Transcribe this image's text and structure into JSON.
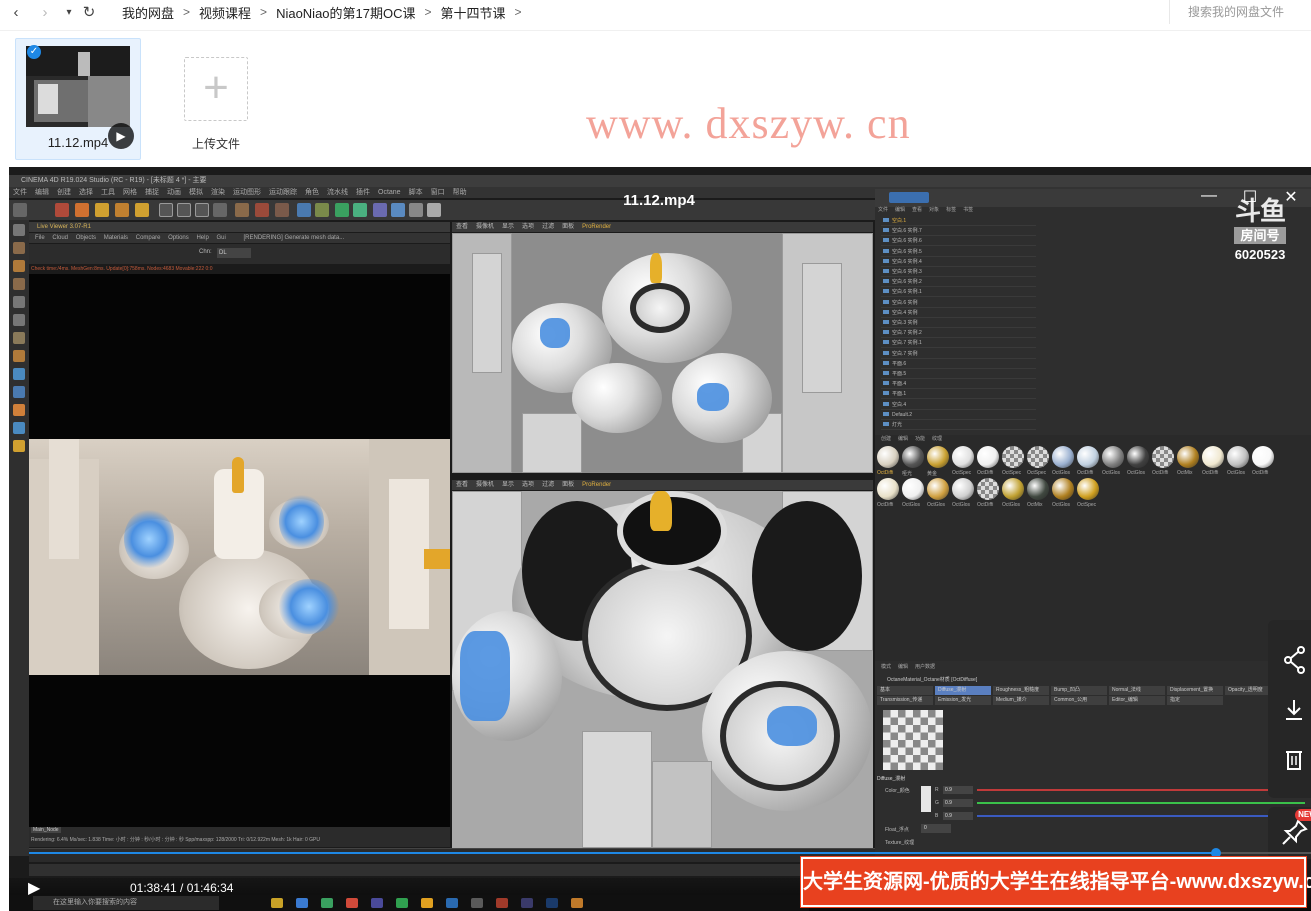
{
  "nav": {
    "back_icon": "‹",
    "forward_icon": "›",
    "history_icon": "▾",
    "refresh_icon": "↻",
    "breadcrumbs": [
      "我的网盘",
      "视频课程",
      "NiaoNiao的第17期OC课",
      "第十四节课"
    ],
    "separator": ">",
    "search_placeholder": "搜索我的网盘文件"
  },
  "files": {
    "selected_file": "11.12.mp4",
    "upload_label": "上传文件",
    "upload_icon": "+"
  },
  "watermark": "www. dxszyw. cn",
  "player": {
    "title": "11.12.mp4",
    "current_time": "01:38:41",
    "total_time": "01:46:34",
    "time_separator": " / ",
    "progress_fraction": 0.926,
    "room": {
      "logo": "斗鱼",
      "label": "房间号",
      "number": "6020523"
    },
    "window_controls": {
      "minimize": "—",
      "maximize": "☐",
      "close": "✕"
    }
  },
  "c4d": {
    "titlebar": "CINEMA 4D R19.024 Studio (RC - R19) - [未标题 4 *] - 主要",
    "menu": [
      "文件",
      "编辑",
      "创建",
      "选择",
      "工具",
      "网格",
      "捕捉",
      "动画",
      "模拟",
      "渲染",
      "运动图形",
      "运动跟踪",
      "角色",
      "流水线",
      "插件",
      "Octane",
      "脚本",
      "窗口",
      "帮助"
    ],
    "live_viewer_title": "Live Viewer 3.07-R1",
    "live_viewer_menu": [
      "File",
      "Cloud",
      "Objects",
      "Materials",
      "Compare",
      "Options",
      "Help",
      "Gui"
    ],
    "live_viewer_status": "[RENDERING] Generate mesh data...",
    "live_viewer_check": "Check time:/4ms. MeshGen:8ms. Update[0]:758ms. Nodes:4683 Movable:222 0:0",
    "channel_label": "Chn:",
    "channel_value": "DL",
    "render_tag": "Main_Node",
    "render_info": "Rendering: 6.4%   Ms/sec: 1.838   Time: 小时 : 分钟 : 秒/小时 : 分钟 : 秒   Spp/maxspp: 128/2000   Tri: 0/12.922m   Mesh: 1k   Hair: 0   GPU",
    "viewport_menu": [
      "查看",
      "摄像机",
      "显示",
      "选项",
      "过滤",
      "面板",
      "ProRender"
    ],
    "outliner_tabs": [
      "文件",
      "编辑",
      "查看",
      "对象",
      "标签",
      "书签"
    ],
    "outliner_rows": [
      "空白.1",
      "空白.6 实例.7",
      "空白.6 实例.6",
      "空白.6 实例.5",
      "空白.6 实例.4",
      "空白.6 实例.3",
      "空白.6 实例.2",
      "空白.6 实例.1",
      "空白.6 实例",
      "空白.4 实例",
      "空白.3 实例",
      "空白.7 实例.2",
      "空白.7 实例.1",
      "空白.7 实例",
      "平面.6",
      "平面.5",
      "平面.4",
      "平面.1",
      "空白.4",
      "Default.2",
      "灯光"
    ],
    "material_tabs": [
      "创建",
      "编辑",
      "功能",
      "纹理"
    ],
    "materials": [
      "OctDiffi",
      "哑光",
      "黄金",
      "OctSpec",
      "OctDiffi",
      "OctSpec",
      "OctSpec",
      "OctGlos",
      "OctDiffi",
      "OctGlos",
      "OctGlos",
      "OctDiffi",
      "OctMix",
      "OctDiffi",
      "OctGlos",
      "OctDiffi",
      "OctDiffi",
      "OctGlos",
      "OctGlos",
      "OctGlos",
      "OctDiffi",
      "OctGlos",
      "OctMix",
      "OctGlos",
      "OctSpec"
    ],
    "attr_menu": [
      "模式",
      "编辑",
      "用户数据"
    ],
    "material_name": "OctaneMaterial_Octane材质 [OctDiffuse]",
    "attr_tabs": [
      "基本",
      "Diffuse_漫射",
      "Roughness_粗糙度",
      "Bump_凹凸",
      "Normal_法线",
      "Displacement_置换",
      "Opacity_透明度",
      "Transmission_传递",
      "Emission_发光",
      "Medium_媒介",
      "Common_公用",
      "Editor_编辑",
      "指定"
    ],
    "diffuse_section": "Diffuse_漫射",
    "color_label": "Color_颜色",
    "rgb": [
      {
        "ch": "R",
        "v": "0.9"
      },
      {
        "ch": "G",
        "v": "0.9"
      },
      {
        "ch": "B",
        "v": "0.9"
      }
    ],
    "float_label": "Float_浮点",
    "float_value": "0",
    "texture_label": "Texture_纹理",
    "taskbar_search": "在这里输入你要搜索的内容"
  },
  "ad_banner": "大学生资源网-优质的大学生在线指导平台-www.dxszyw.cn"
}
